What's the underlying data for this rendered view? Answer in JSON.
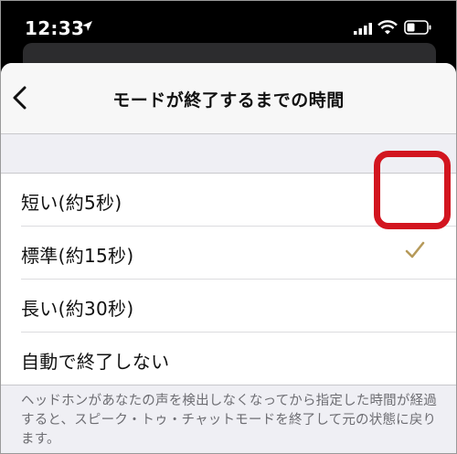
{
  "status_bar": {
    "time": "12:33",
    "icons": [
      "location-arrow-icon",
      "cellular-signal-icon",
      "wifi-icon",
      "battery-icon"
    ]
  },
  "nav": {
    "back_icon": "chevron-left-icon",
    "title": "モードが終了するまでの時間"
  },
  "options": [
    {
      "label": "短い(約5秒)",
      "selected": false
    },
    {
      "label": "標準(約15秒)",
      "selected": true
    },
    {
      "label": "長い(約30秒)",
      "selected": false
    },
    {
      "label": "自動で終了しない",
      "selected": false
    }
  ],
  "footer": {
    "description": "ヘッドホンがあなたの声を検出しなくなってから指定した時間が経過すると、スピーク・トゥ・チャットモードを終了して元の状態に戻ります。"
  },
  "colors": {
    "checkmark": "#b69a5a",
    "highlight": "#d2151f",
    "sheet_bg": "#efeff4",
    "nav_bg": "#f7f7f7"
  }
}
